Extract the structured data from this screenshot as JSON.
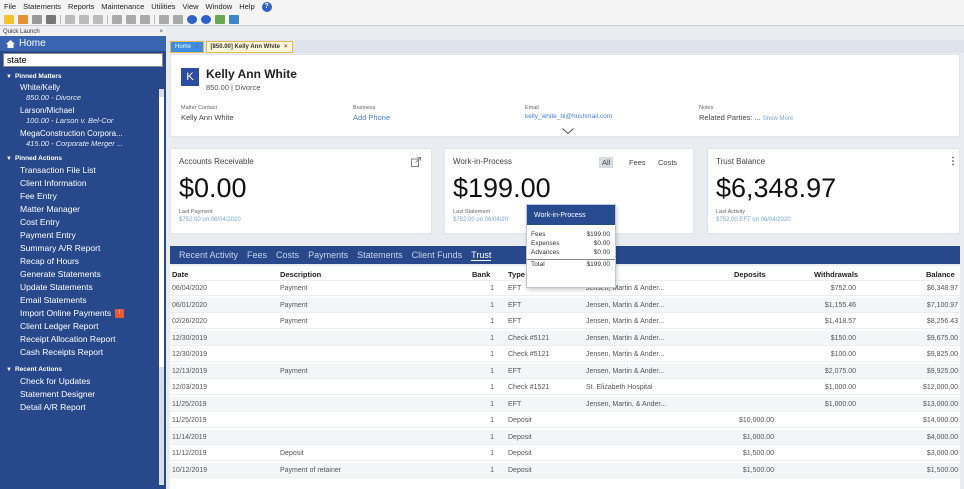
{
  "menu": [
    "File",
    "Statements",
    "Reports",
    "Maintenance",
    "Utilities",
    "View",
    "Window",
    "Help"
  ],
  "sidebar": {
    "quick_launch": "Quick Launch",
    "home": "Home",
    "search_value": "state",
    "pinned_matters_title": "Pinned Matters",
    "matters": [
      {
        "name": "White/Kelly",
        "sub": "850.00 - Divorce"
      },
      {
        "name": "Larson/Michael",
        "sub": "100.00 - Larson v. Bel-Cor"
      },
      {
        "name": "MegaConstruction Corpora...",
        "sub": "415.00 - Corporate Merger ..."
      }
    ],
    "pinned_actions_title": "Pinned Actions",
    "actions": [
      "Transaction File List",
      "Client Information",
      "Fee Entry",
      "Matter Manager",
      "Cost Entry",
      "Payment Entry",
      "Summary A/R Report",
      "Recap of Hours",
      "Generate Statements",
      "Update Statements",
      "Email Statements",
      "Import Online Payments",
      "Client Ledger Report",
      "Receipt Allocation Report",
      "Cash Receipts Report"
    ],
    "recent_actions_title": "Recent Actions",
    "recent": [
      "Check for Updates",
      "Statement Designer",
      "Detail A/R Report"
    ]
  },
  "tabs": [
    {
      "label": "Home"
    },
    {
      "label": "[850.00] Kelly Ann White"
    }
  ],
  "client": {
    "avatar": "K",
    "name": "Kelly Ann White",
    "matter_line": "850.00 | Divorce",
    "matter_contact_label": "Matter Contact",
    "matter_contact": "Kelly Ann White",
    "business_label": "Business",
    "business_link": "Add Phone",
    "email_label": "Email",
    "email": "kelly_white_bl@hushmail.com",
    "notes_label": "Notes",
    "related_parties": "Related Parties: ...",
    "show_more": "Show More"
  },
  "kpis": {
    "ar": {
      "title": "Accounts Receivable",
      "amount": "$0.00",
      "sub_label": "Last Payment",
      "sub_value": "$752.00 on 06/04/2020"
    },
    "wip": {
      "title": "Work-in-Process",
      "amount": "$199.00",
      "sub_label": "Last Statement",
      "sub_value": "$752.00 on 06/04/20",
      "filters": [
        "All",
        "Fees",
        "Costs"
      ]
    },
    "trust": {
      "title": "Trust Balance",
      "amount": "$6,348.97",
      "sub_label": "Last Activity",
      "sub_value": "$752.00 EFT on 06/04/2020"
    }
  },
  "wip_popup": {
    "title": "Work-in-Process",
    "rows": [
      {
        "label": "Fees",
        "value": "$199.00"
      },
      {
        "label": "Expenses",
        "value": "$0.00"
      },
      {
        "label": "Advances",
        "value": "$0.00"
      }
    ],
    "total_label": "Total",
    "total_value": "$199.00"
  },
  "activity_tabs": [
    "Recent Activity",
    "Fees",
    "Costs",
    "Payments",
    "Statements",
    "Client Funds",
    "Trust"
  ],
  "table": {
    "headers": {
      "date": "Date",
      "desc": "Description",
      "bank": "Bank",
      "type": "Type",
      "payee": "",
      "deposits": "Deposits",
      "withdrawals": "Withdrawals",
      "balance": "Balance"
    },
    "rows": [
      {
        "date": "06/04/2020",
        "desc": "Payment",
        "bank": "1",
        "type": "EFT",
        "payee": "Jensen, Martin & Ander...",
        "deposits": "",
        "withdrawals": "$752.00",
        "balance": "$6,348.97"
      },
      {
        "date": "06/01/2020",
        "desc": "Payment",
        "bank": "1",
        "type": "EFT",
        "payee": "Jensen, Martin & Ander...",
        "deposits": "",
        "withdrawals": "$1,155.46",
        "balance": "$7,100.97"
      },
      {
        "date": "02/26/2020",
        "desc": "Payment",
        "bank": "1",
        "type": "EFT",
        "payee": "Jensen, Martin & Ander...",
        "deposits": "",
        "withdrawals": "$1,418.57",
        "balance": "$8,256.43"
      },
      {
        "date": "12/30/2019",
        "desc": "",
        "bank": "1",
        "type": "Check #5121",
        "payee": "Jensen, Martin & Ander...",
        "deposits": "",
        "withdrawals": "$150.00",
        "balance": "$9,675.00"
      },
      {
        "date": "12/30/2019",
        "desc": "",
        "bank": "1",
        "type": "Check #5121",
        "payee": "Jensen, Martin & Ander...",
        "deposits": "",
        "withdrawals": "$100.00",
        "balance": "$9,825.00"
      },
      {
        "date": "12/13/2019",
        "desc": "Payment",
        "bank": "1",
        "type": "EFT",
        "payee": "Jensen, Martin & Ander...",
        "deposits": "",
        "withdrawals": "$2,075.00",
        "balance": "$9,925.00"
      },
      {
        "date": "12/03/2019",
        "desc": "",
        "bank": "1",
        "type": "Check #1521",
        "payee": "St. Elizabeth Hospital",
        "deposits": "",
        "withdrawals": "$1,000.00",
        "balance": "$12,000.00"
      },
      {
        "date": "11/25/2019",
        "desc": "",
        "bank": "1",
        "type": "EFT",
        "payee": "Jensen, Martin, & Ander...",
        "deposits": "",
        "withdrawals": "$1,000.00",
        "balance": "$13,000.00"
      },
      {
        "date": "11/25/2019",
        "desc": "",
        "bank": "1",
        "type": "Deposit",
        "payee": "",
        "deposits": "$10,000.00",
        "withdrawals": "",
        "balance": "$14,000.00"
      },
      {
        "date": "11/14/2019",
        "desc": "",
        "bank": "1",
        "type": "Deposit",
        "payee": "",
        "deposits": "$1,000.00",
        "withdrawals": "",
        "balance": "$4,000.00"
      },
      {
        "date": "11/12/2019",
        "desc": "Deposit",
        "bank": "1",
        "type": "Deposit",
        "payee": "",
        "deposits": "$1,500.00",
        "withdrawals": "",
        "balance": "$3,000.00"
      },
      {
        "date": "10/12/2019",
        "desc": "Payment of retainer",
        "bank": "1",
        "type": "Deposit",
        "payee": "",
        "deposits": "$1,500.00",
        "withdrawals": "",
        "balance": "$1,500.00"
      }
    ]
  },
  "colors": {
    "sidebar": "#27488a",
    "accent": "#284b8f",
    "link": "#4a7fd0"
  }
}
